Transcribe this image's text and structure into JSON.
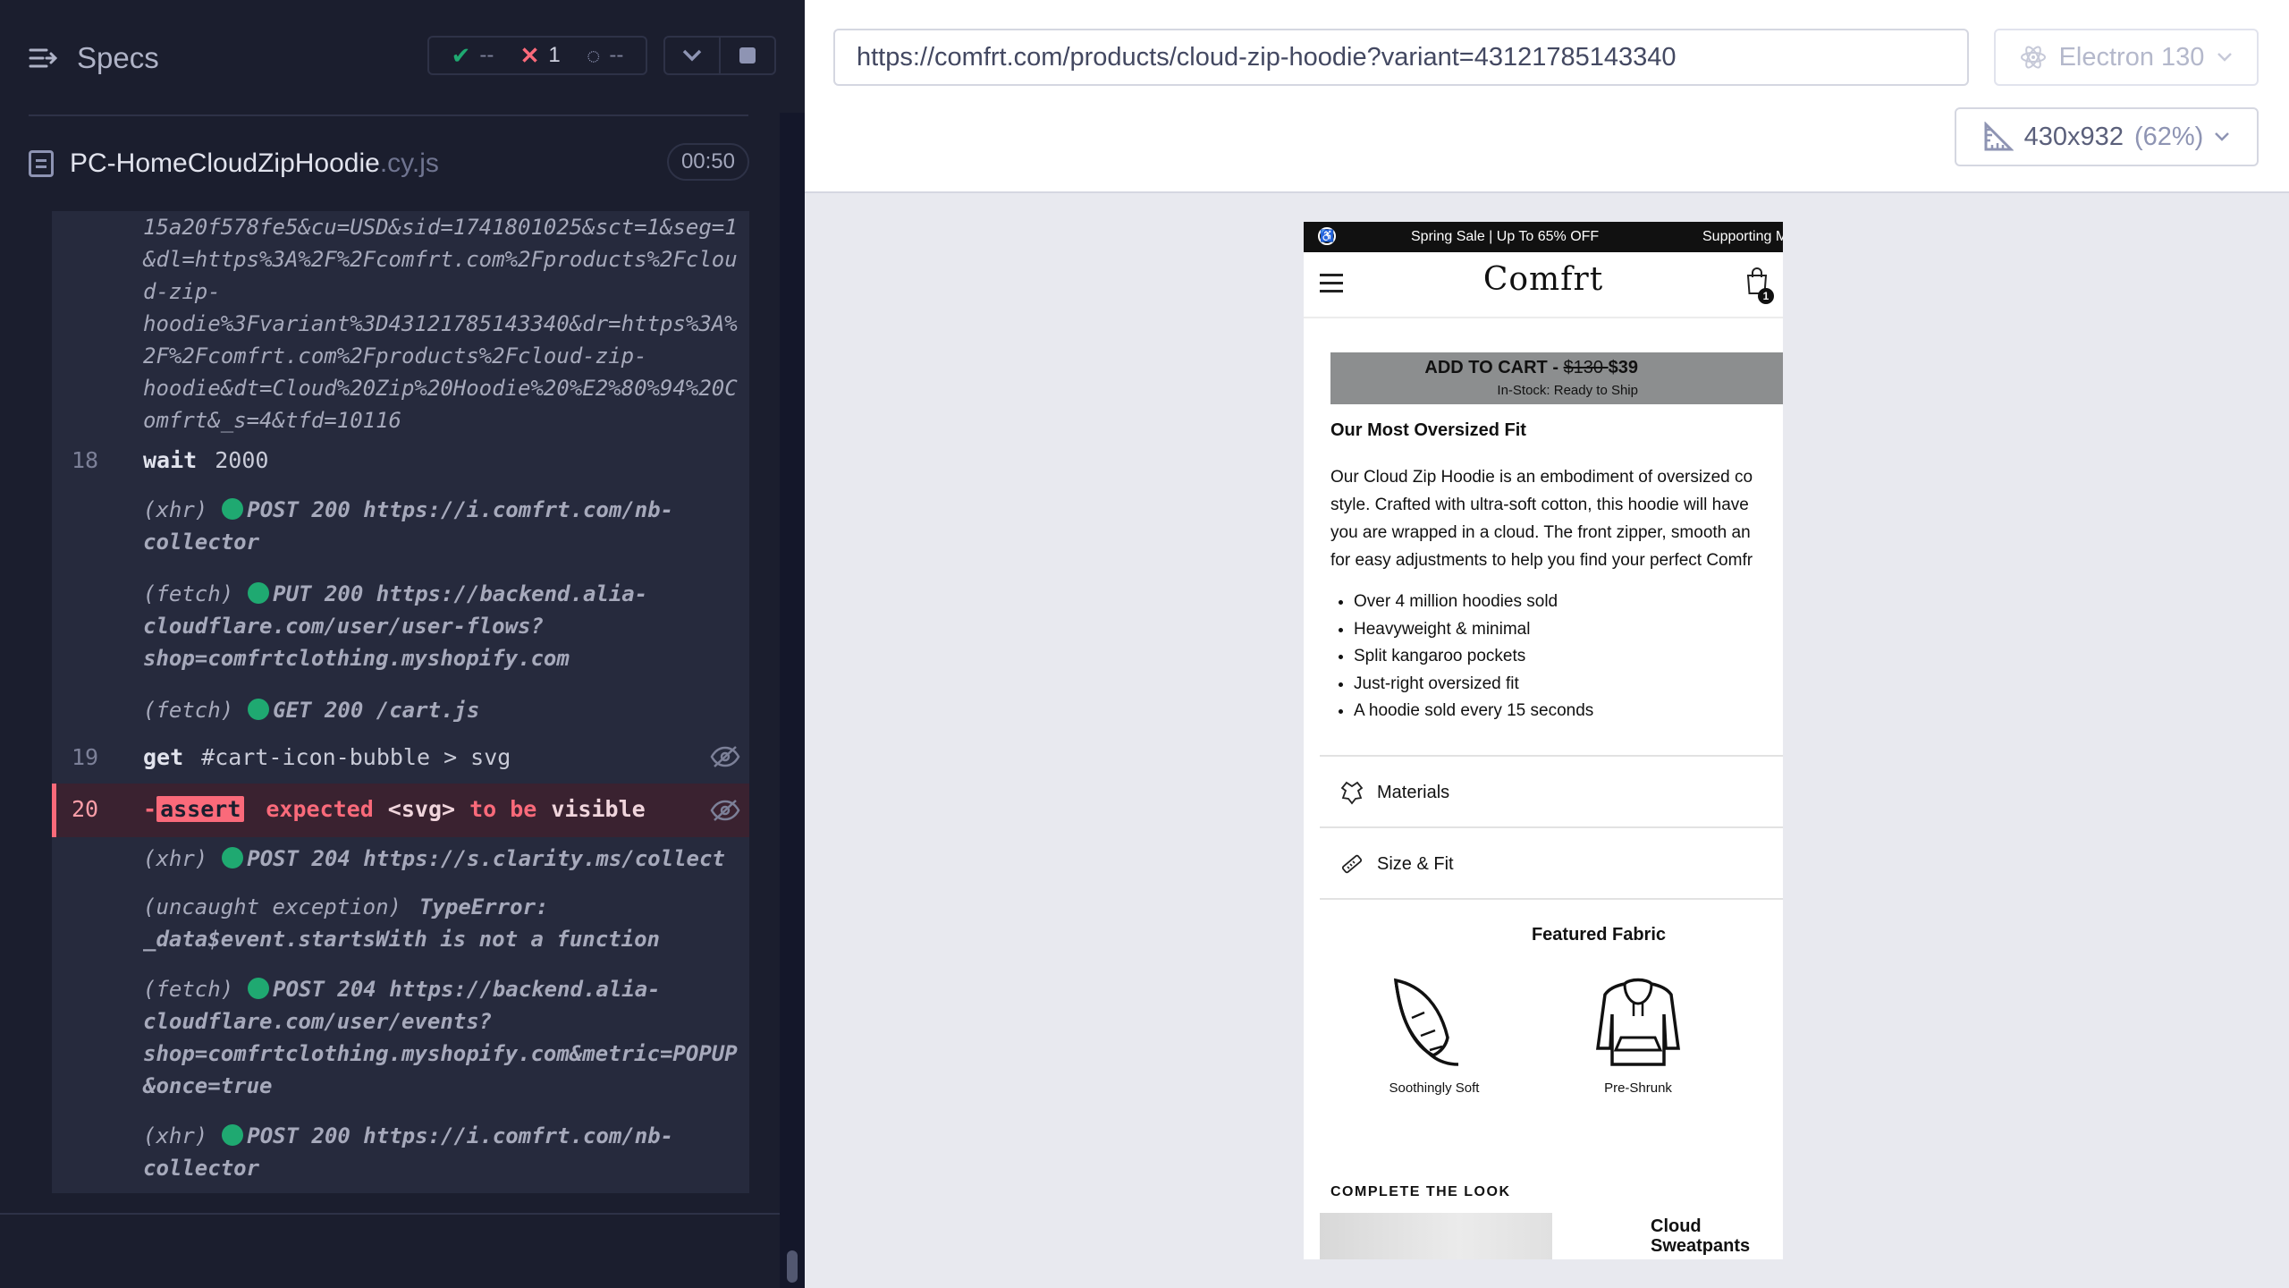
{
  "reporter": {
    "specs_label": "Specs",
    "stats": {
      "passed": "--",
      "failed": "1",
      "pending": "--"
    },
    "spec_name": "PC-HomeCloudZipHoodie",
    "spec_ext": ".cy.js",
    "timer": "00:50"
  },
  "commands": {
    "url_fragment": [
      "15a20f578fe5&cu=USD&sid=1741801025&sct=1&seg=1",
      "&dl=https%3A%2F%2Fcomfrt.com%2Fproducts%2Fclou",
      "d-zip-",
      "hoodie%3Fvariant%3D43121785143340&dr=https%3A%",
      "2F%2Fcomfrt.com%2Fproducts%2Fcloud-zip-",
      "hoodie&dt=Cloud%20Zip%20Hoodie%20%E2%80%94%20C",
      "omfrt&_s=4&tfd=10116"
    ],
    "cmd18": {
      "num": "18",
      "name": "wait",
      "msg": "2000"
    },
    "log1": {
      "kind": "(xhr)",
      "line1": "POST 200 https://i.comfrt.com/nb-",
      "line2": "collector"
    },
    "log2": {
      "kind": "(fetch)",
      "line1": "PUT 200 https://backend.alia-",
      "line2": "cloudflare.com/user/user-flows?",
      "line3": "shop=comfrtclothing.myshopify.com"
    },
    "log3": {
      "kind": "(fetch)",
      "line1": "GET 200 /cart.js"
    },
    "cmd19": {
      "num": "19",
      "name": "get",
      "msg": "#cart-icon-bubble > svg"
    },
    "cmd20": {
      "num": "20",
      "dash": "-",
      "name": "assert",
      "w1": "expected",
      "w2": "<svg>",
      "w3": "to be",
      "w4": "visible"
    },
    "log4": {
      "kind": "(xhr)",
      "line1": "POST 204 https://s.clarity.ms/collect"
    },
    "log5": {
      "kind": "(uncaught exception)",
      "line1": "TypeError:",
      "line2": "_data$event.startsWith is not a function"
    },
    "log6": {
      "kind": "(fetch)",
      "line1": "POST 204 https://backend.alia-",
      "line2": "cloudflare.com/user/events?",
      "line3": "shop=comfrtclothing.myshopify.com&metric=POPUP",
      "line4": "&once=true"
    },
    "log7": {
      "kind": "(xhr)",
      "line1": "POST 200 https://i.comfrt.com/nb-",
      "line2": "collector"
    }
  },
  "aut": {
    "url": "https://comfrt.com/products/cloud-zip-hoodie?variant=43121785143340",
    "browser": "Electron 130",
    "viewport": "430x932",
    "viewport_pct": "(62%)"
  },
  "site": {
    "announce": {
      "left": "Spring Sale | Up To 65% OFF",
      "right": "Supporting M"
    },
    "logo": "Comfrt",
    "cart_count": "1",
    "atc": {
      "prefix": "ADD TO CART - ",
      "old_price": "$130 ",
      "price": "$39",
      "stock": "In-Stock: Ready to Ship"
    },
    "heading": "Our Most Oversized Fit",
    "desc": [
      "Our Cloud Zip Hoodie is an embodiment of oversized co",
      "style. Crafted with ultra-soft cotton, this hoodie will have",
      "you are wrapped in a cloud. The front zipper, smooth an",
      "for easy adjustments to help you find your perfect Comfr"
    ],
    "bullets": [
      "Over 4 million hoodies sold",
      "Heavyweight & minimal",
      "Split kangaroo pockets",
      "Just-right oversized fit",
      "A hoodie sold every 15 seconds"
    ],
    "accordion": {
      "materials": "Materials",
      "size_fit": "Size & Fit"
    },
    "featured_title": "Featured Fabric",
    "fabrics": [
      "Soothingly Soft",
      "Pre-Shrunk"
    ],
    "complete_look": "COMPLETE THE LOOK",
    "look_product": "Cloud Sweatpants"
  }
}
